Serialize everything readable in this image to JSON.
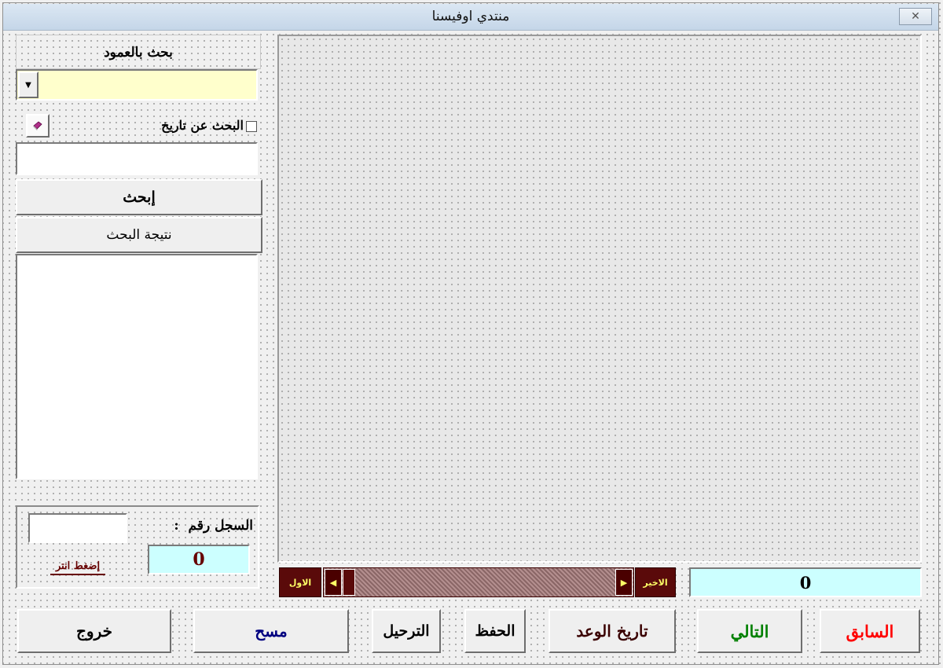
{
  "window": {
    "title": "منتدي اوفيسنا",
    "close_glyph": "✕"
  },
  "search_panel": {
    "column_search_label": "بحث بالعمود",
    "column_value": "",
    "dropdown_arrow": "▼",
    "date_search_label": "البحث عن تاريخ",
    "date_search_checked": false,
    "date_value": "",
    "search_button": "إبحث",
    "result_header": "نتيجة البحث",
    "results": []
  },
  "record_panel": {
    "record_label": "السجل رقم  :",
    "record_input_value": "",
    "record_number": "0",
    "press_enter_label": "إضغط انتر"
  },
  "navigation": {
    "first_label": "الاول",
    "last_label": "الاخير",
    "left_arrow": "◀",
    "right_arrow": "▶",
    "counter_value": "0"
  },
  "buttons": {
    "exit": "خروج",
    "clear": "مسح",
    "transfer": "الترحيل",
    "save": "الحفظ",
    "appointment_date": "تاريخ الوعد",
    "next": "التالي",
    "previous": "السابق"
  },
  "colors": {
    "clear_text": "#000080",
    "next_text": "#008000",
    "previous_text": "#ff0000",
    "appointment_text": "#3a0000",
    "record_number_text": "#660000"
  }
}
